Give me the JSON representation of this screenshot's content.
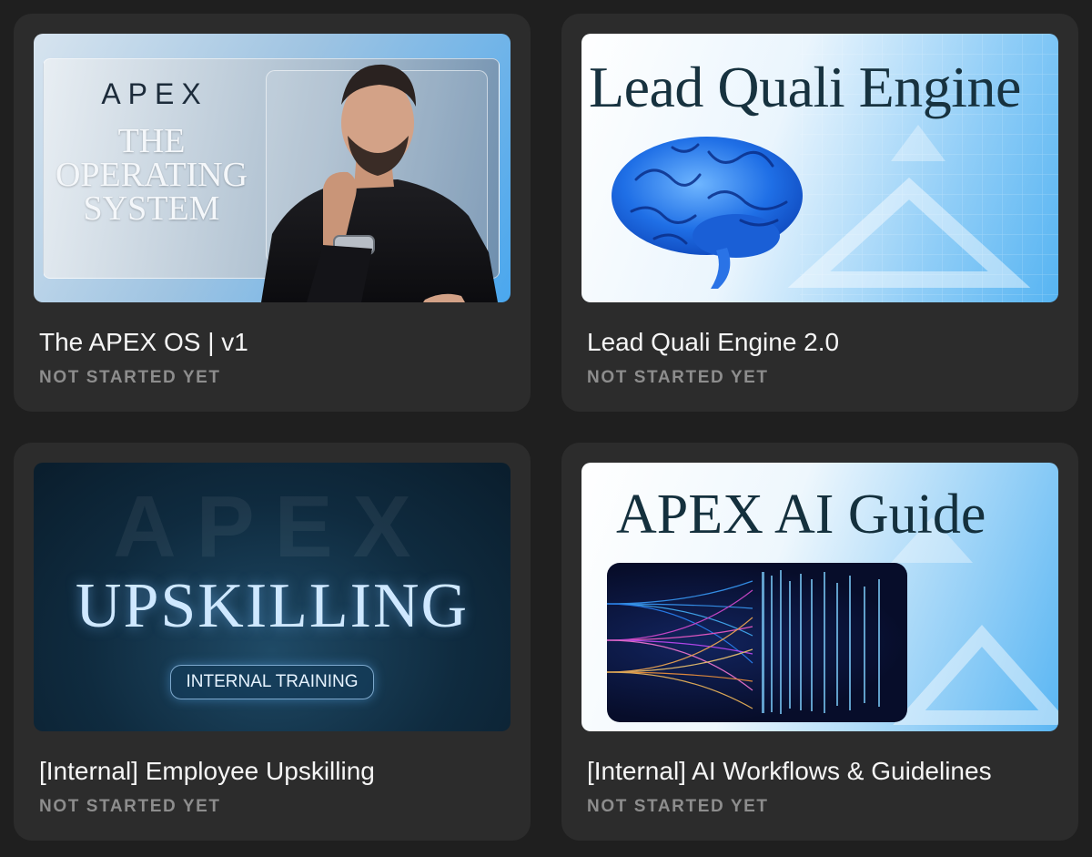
{
  "courses": [
    {
      "title": "The APEX OS | v1",
      "status": "NOT STARTED YET",
      "thumbnail": {
        "logo": "APEX",
        "headline_lines": [
          "THE",
          "OPERATING",
          "SYSTEM"
        ]
      }
    },
    {
      "title": "Lead Quali Engine 2.0",
      "status": "NOT STARTED YET",
      "thumbnail": {
        "headline": "Lead Quali Engine"
      }
    },
    {
      "title": "[Internal] Employee Upskilling",
      "status": "NOT STARTED YET",
      "thumbnail": {
        "ghost_text": "APEX",
        "headline": "UPSKILLING",
        "badge": "INTERNAL TRAINING"
      }
    },
    {
      "title": "[Internal] AI Workflows & Guidelines",
      "status": "NOT STARTED YET",
      "thumbnail": {
        "headline": "APEX AI Guide"
      }
    }
  ],
  "colors": {
    "page_background": "#1f1f1f",
    "card_background": "#2c2c2c",
    "title_text": "#f5f5f5",
    "status_text": "#8d8d8d",
    "accent_blue": "#4aa7ee"
  }
}
